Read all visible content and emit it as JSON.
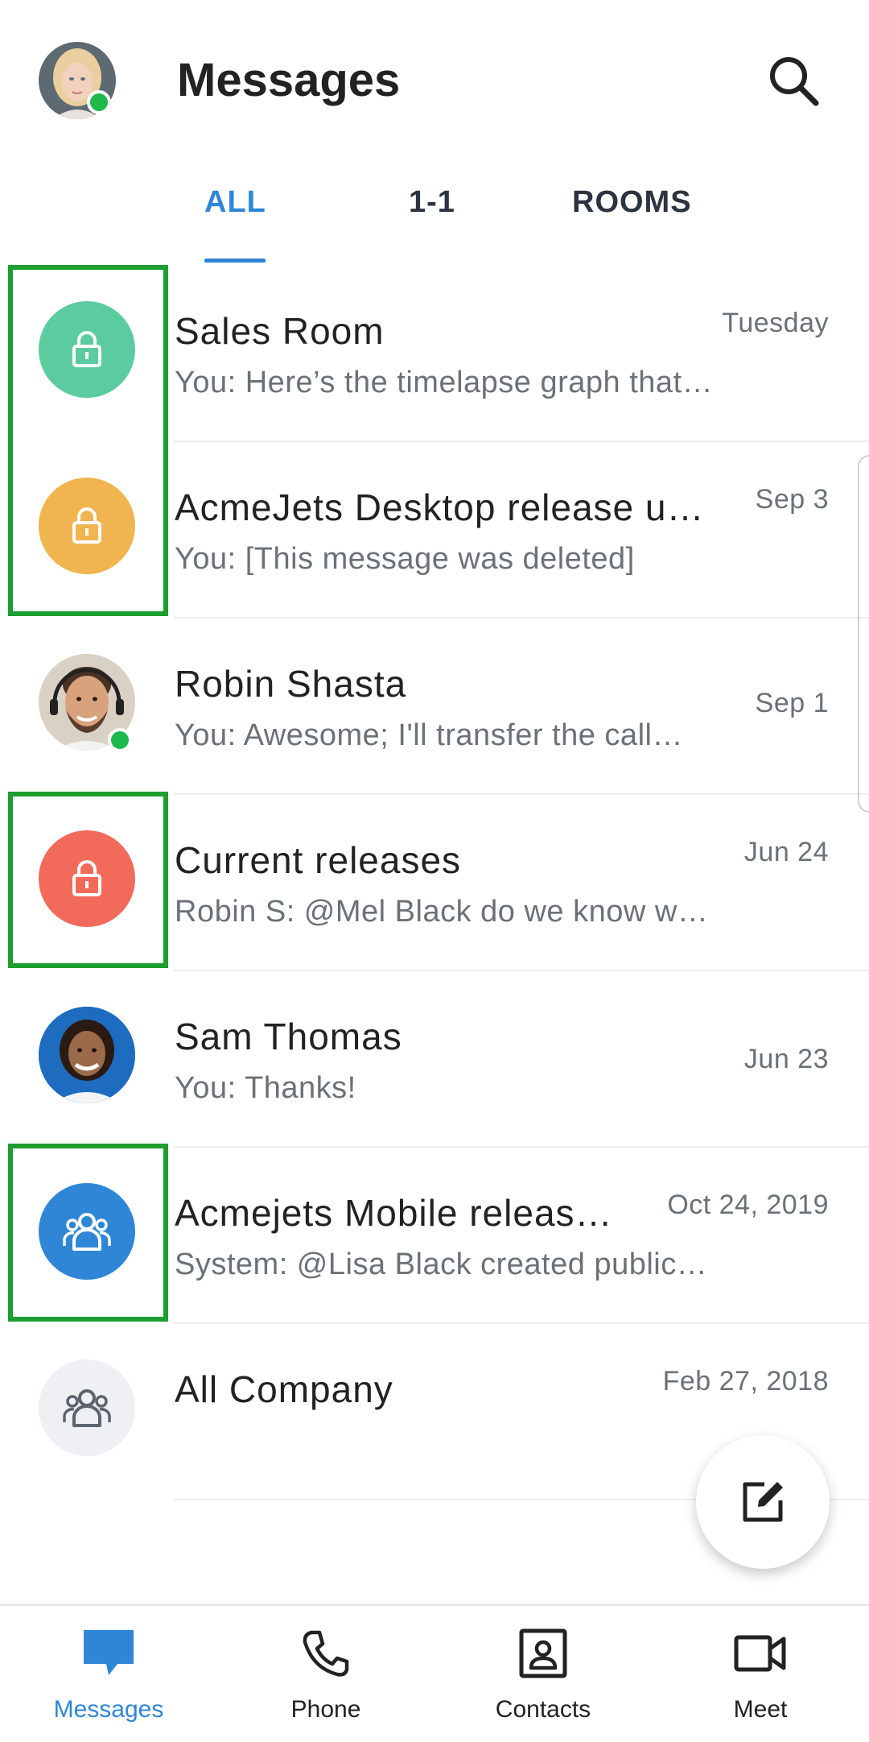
{
  "header": {
    "title": "Messages",
    "search_icon": "search-icon",
    "user_presence": "online"
  },
  "tabs": [
    {
      "label": "ALL",
      "active": true
    },
    {
      "label": "1-1",
      "active": false
    },
    {
      "label": "ROOMS",
      "active": false
    }
  ],
  "conversations": [
    {
      "name": "Sales Room",
      "preview": "You: Here’s the timelapse graph that…",
      "date": "Tuesday",
      "avatar": "lock-icon",
      "avatar_color": "#5ccca0"
    },
    {
      "name": "AcmeJets Desktop release u…",
      "preview": "You: [This message was deleted]",
      "date": "Sep 3",
      "avatar": "lock-icon",
      "avatar_color": "#f0b450"
    },
    {
      "name": "Robin Shasta",
      "preview": "You: Awesome; I'll transfer the call…",
      "date": "Sep 1",
      "avatar": "photo",
      "presence": "online"
    },
    {
      "name": "Current releases",
      "preview": "Robin S: @Mel Black do we know w…",
      "date": "Jun 24",
      "avatar": "lock-icon",
      "avatar_color": "#f26a5a"
    },
    {
      "name": "Sam Thomas",
      "preview": "You: Thanks!",
      "date": "Jun 23",
      "avatar": "photo"
    },
    {
      "name": "Acmejets Mobile releas…",
      "preview": "System: @Lisa Black created public…",
      "date": "Oct 24, 2019",
      "avatar": "group-icon",
      "avatar_color": "#2f86d7"
    },
    {
      "name": "All Company",
      "preview": "",
      "date": "Feb 27, 2018",
      "avatar": "group-icon",
      "avatar_color": "#eef0f3"
    }
  ],
  "fab": {
    "icon": "compose-icon"
  },
  "bottom_nav": [
    {
      "label": "Messages",
      "icon": "chat-bubble-icon",
      "active": true
    },
    {
      "label": "Phone",
      "icon": "phone-icon",
      "active": false
    },
    {
      "label": "Contacts",
      "icon": "contact-card-icon",
      "active": false
    },
    {
      "label": "Meet",
      "icon": "video-camera-icon",
      "active": false
    }
  ],
  "colors": {
    "accent": "#2f86d7",
    "highlight_box": "#1e9e2f",
    "online": "#1fb84d"
  }
}
